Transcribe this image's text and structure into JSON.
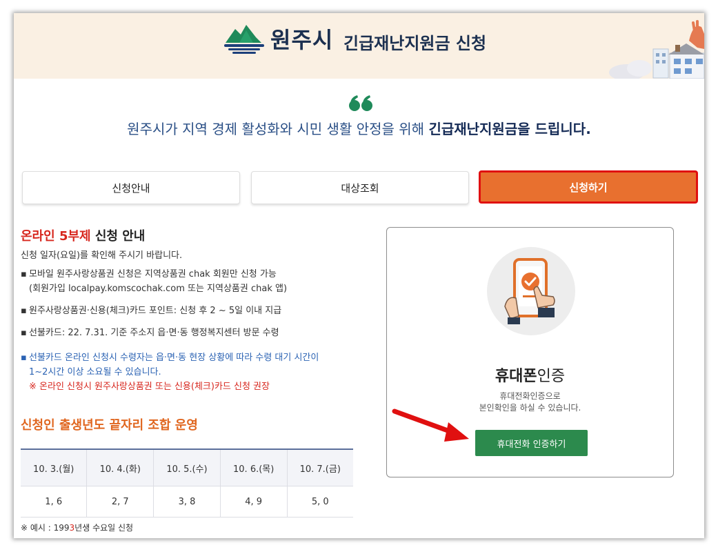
{
  "header": {
    "city_name": "원주시",
    "title": "긴급재난지원금 신청"
  },
  "headline": {
    "text_regular": "원주시가 지역 경제 활성화와 시민 생활 안정을 위해 ",
    "text_bold": "긴급재난지원금을 드립니다."
  },
  "tabs": [
    {
      "label": "신청안내",
      "active": false
    },
    {
      "label": "대상조회",
      "active": false
    },
    {
      "label": "신청하기",
      "active": true
    }
  ],
  "guide": {
    "title_red": "온라인 5부제",
    "title_rest": " 신청 안내",
    "subtitle": "신청 일자(요일)를 확인해 주시기 바랍니다.",
    "bullets": [
      {
        "line1": "모바일 원주사랑상품권 신청은 지역상품권 chak 회원만 신청 가능",
        "line2": "(회원가입 localpay.komscochak.com 또는 지역상품권 chak 앱)"
      },
      {
        "line1": "원주사랑상품권·신용(체크)카드 포인트: 신청 후 2 ~ 5일 이내 지급"
      },
      {
        "line1": "선불카드: 22. 7.31. 기준 주소지 읍·면·동 행정복지센터 방문 수령"
      },
      {
        "line1": "선불카드 온라인 신청시 수령자는 읍·면·동 현장 상황에 따라 수령 대기 시간이",
        "line2": "1~2시간 이상 소요될 수 있습니다.",
        "warning": "※ 온라인 신청시 원주사랑상품권 또는 신용(체크)카드 신청 권장"
      }
    ]
  },
  "schedule": {
    "title": "신청인 출생년도 끝자리 조합 운영",
    "headers": [
      "10. 3.(월)",
      "10. 4.(화)",
      "10. 5.(수)",
      "10. 6.(목)",
      "10. 7.(금)"
    ],
    "values": [
      "1, 6",
      "2, 7",
      "3, 8",
      "4, 9",
      "5, 0"
    ],
    "example_prefix": "※ 예시 : 199",
    "example_highlight": "3",
    "example_suffix": "년생 수요일 신청"
  },
  "cert_card": {
    "title_bold": "휴대폰",
    "title_rest": "인증",
    "desc_line1": "휴대전화인증으로",
    "desc_line2": "본인확인을 하실 수 있습니다.",
    "button_label": "휴대전화 인증하기"
  },
  "colors": {
    "accent_orange": "#e8702f",
    "highlight_border": "#e01010",
    "button_green": "#2c8a4d",
    "navy": "#1c3050",
    "banner_bg": "#faf0e3"
  }
}
